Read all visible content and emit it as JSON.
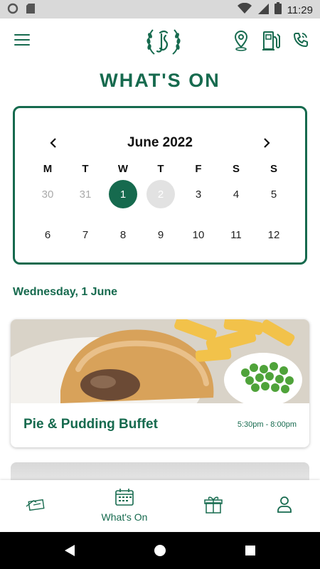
{
  "status_bar": {
    "time": "11:29"
  },
  "header": {
    "title": "WHAT'S ON"
  },
  "calendar": {
    "month_label": "June 2022",
    "weekdays": [
      "M",
      "T",
      "W",
      "T",
      "F",
      "S",
      "S"
    ],
    "week1": [
      "30",
      "31",
      "1",
      "2",
      "3",
      "4",
      "5"
    ],
    "week2": [
      "6",
      "7",
      "8",
      "9",
      "10",
      "11",
      "12"
    ]
  },
  "date_heading": "Wednesday, 1 June",
  "event": {
    "title": "Pie & Pudding Buffet",
    "time": "5:30pm - 8:00pm"
  },
  "bottom_nav": {
    "whats_on_label": "What's On"
  },
  "colors": {
    "brand_green": "#166a4e",
    "today_grey": "#e2e2e2"
  },
  "icons": [
    "menu-icon",
    "location-pin-icon",
    "fuel-pump-icon",
    "phone-icon",
    "chevron-left-icon",
    "chevron-right-icon",
    "ticket-icon",
    "calendar-icon",
    "gift-icon",
    "user-icon"
  ]
}
